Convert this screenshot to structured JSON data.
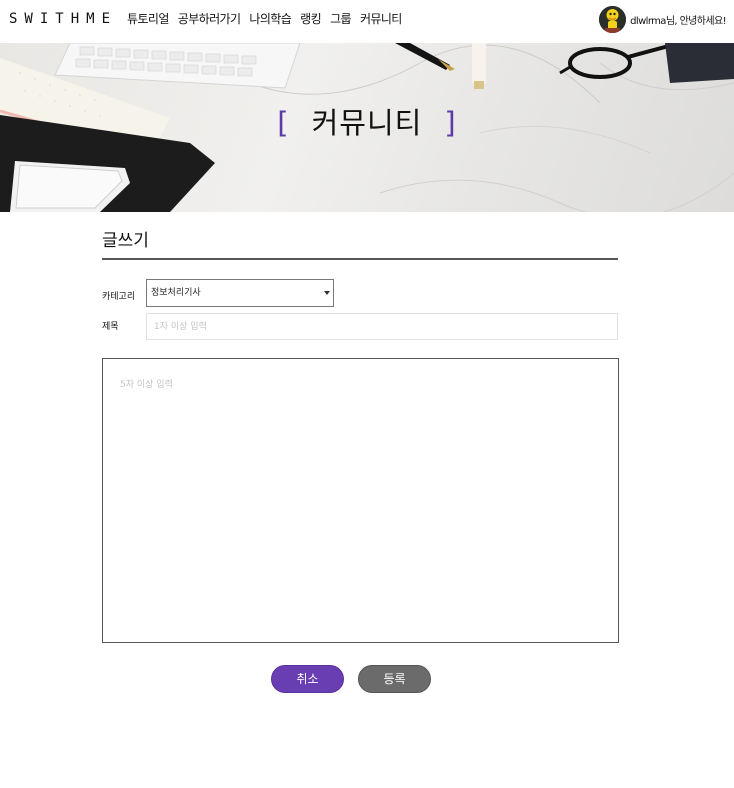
{
  "navbar": {
    "logo": "SWITHME",
    "menu": [
      "튜토리얼",
      "공부하러가기",
      "나의학습",
      "랭킹",
      "그룹",
      "커뮤니티"
    ],
    "greeting": "dlwlrma님, 안녕하세요!"
  },
  "hero": {
    "bracket_open": "[",
    "title": "커뮤니티",
    "bracket_close": "]",
    "accent_color": "#5d3aa8"
  },
  "form": {
    "heading": "글쓰기",
    "category_label": "카테고리",
    "category_value": "정보처리기사",
    "title_label": "제목",
    "title_placeholder": "1자 이상 입력",
    "body_placeholder": "5자 이상 입력",
    "cancel_label": "취소",
    "submit_label": "등록"
  },
  "colors": {
    "cancel_button": "#6a3eb3",
    "submit_button": "#6b6b6b"
  },
  "icons": {
    "avatar": "avatar-icon",
    "select_caret": "caret-down-icon"
  }
}
